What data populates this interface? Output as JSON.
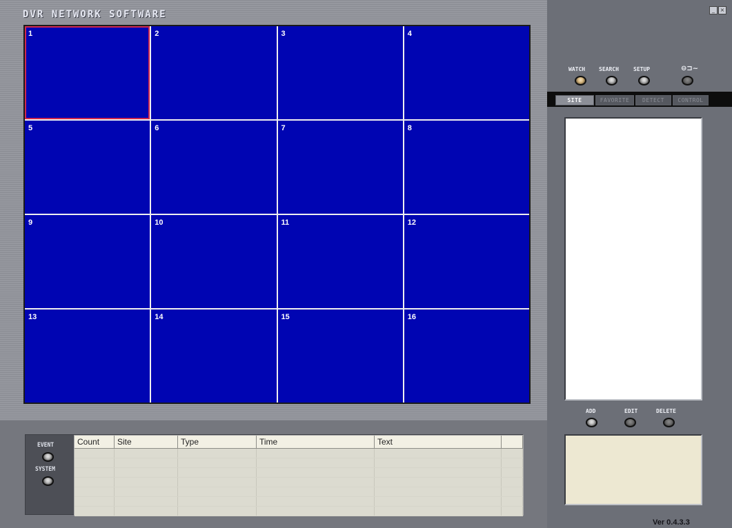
{
  "app": {
    "title": "DVR NETWORK SOFTWARE",
    "version": "Ver 0.4.3.3"
  },
  "channels": [
    "1",
    "2",
    "3",
    "4",
    "5",
    "6",
    "7",
    "8",
    "9",
    "10",
    "11",
    "12",
    "13",
    "14",
    "15",
    "16"
  ],
  "selected_channel": "1",
  "event_panel": {
    "event_label": "EVENT",
    "system_label": "SYSTEM",
    "columns": [
      "Count",
      "Site",
      "Type",
      "Time",
      "Text"
    ]
  },
  "toolbar": {
    "watch_label": "WATCH",
    "search_label": "SEARCH",
    "setup_label": "SETUP"
  },
  "tabs": [
    "SITE",
    "FAVORITE",
    "DETECT",
    "CONTROL"
  ],
  "active_tab": "SITE",
  "site_actions": {
    "add_label": "ADD",
    "edit_label": "EDIT",
    "delete_label": "DELETE"
  },
  "icons": {
    "connect": "plug-connect-icon",
    "minimize": "minimize-icon",
    "close": "close-icon"
  },
  "colors": {
    "channel_bg": "#0005b2",
    "selected_border": "#d0294e"
  }
}
